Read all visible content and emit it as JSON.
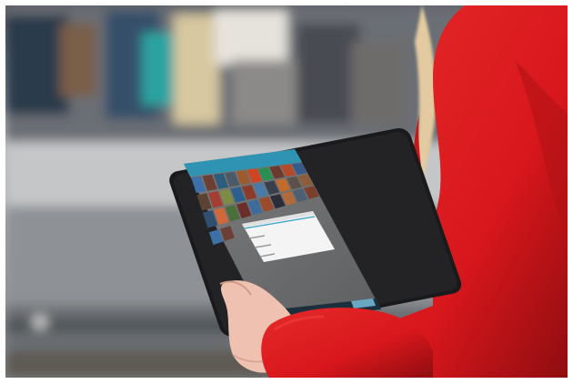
{
  "image": {
    "subject": "person-holding-tablet-at-train-platform",
    "colors": {
      "sleeve_red": "#d8171c",
      "sleeve_shadow": "#8f0d10",
      "hair": "#e8d3ad",
      "skin": "#f0c5b4",
      "tablet_body": "#1a1a1c",
      "screen_header": "#2f94b3",
      "screen_background": "#6c6e70",
      "screen_bar": "#1b2f3c",
      "dialog_accent": "#33a3c8"
    },
    "tablet": {
      "screen_header_icon": "app-bar",
      "grid_tile_colors": [
        "#3c70a6",
        "#6b3f33",
        "#2d5d7a",
        "#4a5a68",
        "#9a5b2e",
        "#d14422",
        "#2c8f52",
        "#6c3a2c",
        "#b54a2a",
        "#375c8c",
        "#5b4334",
        "#a63d32",
        "#7d8b44",
        "#2b5f8f",
        "#8a3b2a",
        "#4a7aa8",
        "#3a3f4d",
        "#c16a2a",
        "#5c5048",
        "#8d5c3b",
        "#2f4f6e",
        "#d0683c",
        "#4c6e3a",
        "#6a2f2a",
        "#3d6b9c",
        "#9c4a2c",
        "#2b2e38",
        "#b26a3a",
        "#4e5f72",
        "#7b3d2c"
      ],
      "dialog_lines": 4
    }
  }
}
